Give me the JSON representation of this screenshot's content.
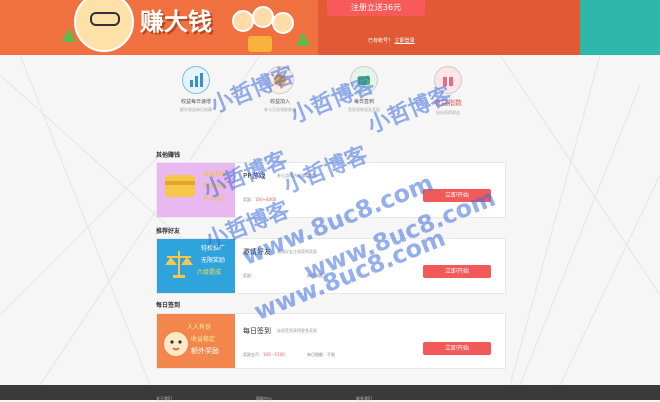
{
  "banner": {
    "headline": "赚大钱",
    "register_button": "注册立送36元",
    "login_hint": "已有帐号？",
    "login_link": "立即登录"
  },
  "tasks": [
    {
      "title": "收益每日速增",
      "sub": "额外收益每日结算"
    },
    {
      "title": "收益加入",
      "sub": "参与活动领取收益"
    },
    {
      "title": "每日签到",
      "sub": "签到领取现金奖励"
    },
    {
      "title": "收益指数",
      "sub": "轻松获得收益"
    }
  ],
  "sections": {
    "other": "其他赚钱",
    "invite": "推荐好友",
    "checkin": "每日签到"
  },
  "cards": [
    {
      "img_lines": [
        "收益指标",
        "项目收益",
        "马上加入"
      ],
      "title": "PP游戏",
      "desc": "参与游戏活动赚取收益",
      "reward_label": "奖励：",
      "reward_value": "100~4000",
      "limit": "",
      "button": "立即开始"
    },
    {
      "img_lines": [
        "轻松推广",
        "无限奖励",
        "六级提成"
      ],
      "title": "邀请好友",
      "desc": "邀请好友注册获得奖励",
      "reward_label": "奖励：",
      "reward_value": "",
      "limit": "每日限额：",
      "button": "立即开始"
    },
    {
      "img_lines": [
        "人人有份",
        "收益稳定",
        "额外奖励"
      ],
      "title": "每日签到",
      "desc": "连续签到获得更多奖励",
      "reward_label": "奖励金币：",
      "reward_value": "100 - 1500",
      "limit": "每日限额：",
      "limit_value": "不限",
      "button": "立即开始"
    }
  ],
  "footer": {
    "col1": "关于我们",
    "col2": "帮助中心",
    "col3": "联系我们"
  },
  "watermarks": [
    {
      "text": "小哲博客",
      "size": 22
    },
    {
      "text": "小哲博客",
      "size": 22
    },
    {
      "text": "小哲博客",
      "size": 22
    },
    {
      "text": "小哲博客",
      "size": 22
    },
    {
      "text": "小哲博客",
      "size": 22
    },
    {
      "text": "小哲博客",
      "size": 22
    },
    {
      "text": "www.8uc8.com",
      "size": 24
    },
    {
      "text": "www.8uc8.com",
      "size": 24
    },
    {
      "text": "www.8uc8.com",
      "size": 24
    }
  ],
  "colors": {
    "brand_orange": "#ee6a3c",
    "button_red": "#f25a5a",
    "accent_teal": "#2eb8ac",
    "watermark_blue": "#3c6edc"
  }
}
